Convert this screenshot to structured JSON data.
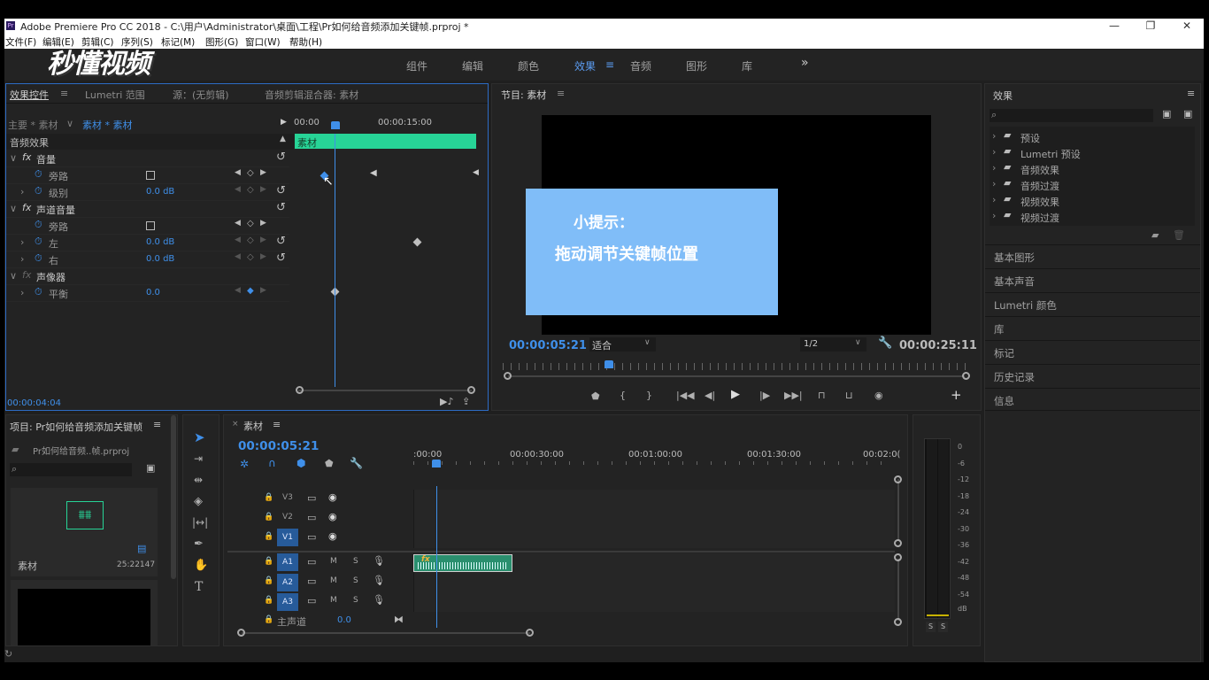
{
  "app": {
    "title": "Adobe Premiere Pro CC 2018 - C:\\用户\\Administrator\\桌面\\工程\\Pr如何给音频添加关键帧.prproj *",
    "logo_text": "Pr",
    "watermark": "秒懂视频"
  },
  "menu": [
    "文件(F)",
    "编辑(E)",
    "剪辑(C)",
    "序列(S)",
    "标记(M)",
    "图形(G)",
    "窗口(W)",
    "帮助(H)"
  ],
  "workspaces": {
    "items": [
      "组件",
      "编辑",
      "颜色",
      "效果",
      "音频",
      "图形",
      "库"
    ],
    "active": "效果",
    "more": "»"
  },
  "effect_controls": {
    "tabs": [
      "效果控件",
      "Lumetri 范围",
      "源：(无剪辑)",
      "音频剪辑混合器: 素材"
    ],
    "master_label": "主要 * 素材",
    "clip_label": "素材 * 素材",
    "ruler": [
      "00:00",
      "00:00:15:00"
    ],
    "clip_bar": "素材",
    "section": "音频效果",
    "rows": [
      {
        "label": "音量",
        "type": "fx"
      },
      {
        "label": "旁路",
        "type": "check"
      },
      {
        "label": "级别",
        "type": "value",
        "value": "0.0 dB"
      },
      {
        "label": "声道音量",
        "type": "fx"
      },
      {
        "label": "旁路",
        "type": "check"
      },
      {
        "label": "左",
        "type": "value",
        "value": "0.0 dB"
      },
      {
        "label": "右",
        "type": "value",
        "value": "0.0 dB"
      },
      {
        "label": "声像器",
        "type": "fx"
      },
      {
        "label": "平衡",
        "type": "value",
        "value": "0.0"
      }
    ],
    "timecode": "00:00:04:04"
  },
  "program": {
    "title": "节目: 素材",
    "tooltip_title": "小提示：",
    "tooltip_body": "拖动调节关键帧位置",
    "timecode": "00:00:05:21",
    "fit": "适合",
    "resolution": "1/2",
    "duration": "00:00:25:11"
  },
  "effects_panel": {
    "title": "效果",
    "folders": [
      "预设",
      "Lumetri 预设",
      "音频效果",
      "音频过渡",
      "视频效果",
      "视频过渡"
    ],
    "sections": [
      "基本图形",
      "基本声音",
      "Lumetri 颜色",
      "库",
      "标记",
      "历史记录",
      "信息"
    ]
  },
  "project": {
    "title": "项目: Pr如何给音频添加关键帧",
    "file": "Pr如何给音频..帧.prproj",
    "clip_name": "素材",
    "clip_duration": "25:22147"
  },
  "timeline": {
    "tab": "素材",
    "timecode": "00:00:05:21",
    "ruler": [
      ":00:00",
      "00:00:30:00",
      "00:01:00:00",
      "00:01:30:00",
      "00:02:0("
    ],
    "video_tracks": [
      "V3",
      "V2",
      "V1"
    ],
    "audio_tracks": [
      "A1",
      "A2",
      "A3"
    ],
    "master_label": "主声道",
    "master_value": "0.0",
    "mute": "M",
    "solo": "S"
  },
  "meter": {
    "ticks": [
      "0",
      "-6",
      "-12",
      "-18",
      "-24",
      "-30",
      "-36",
      "-42",
      "-48",
      "-54",
      "dB"
    ],
    "solo": [
      "S",
      "S"
    ]
  },
  "colors": {
    "accent": "#3f8fe9",
    "clip_green": "#27d497",
    "tooltip_bg": "#80bdf8"
  }
}
